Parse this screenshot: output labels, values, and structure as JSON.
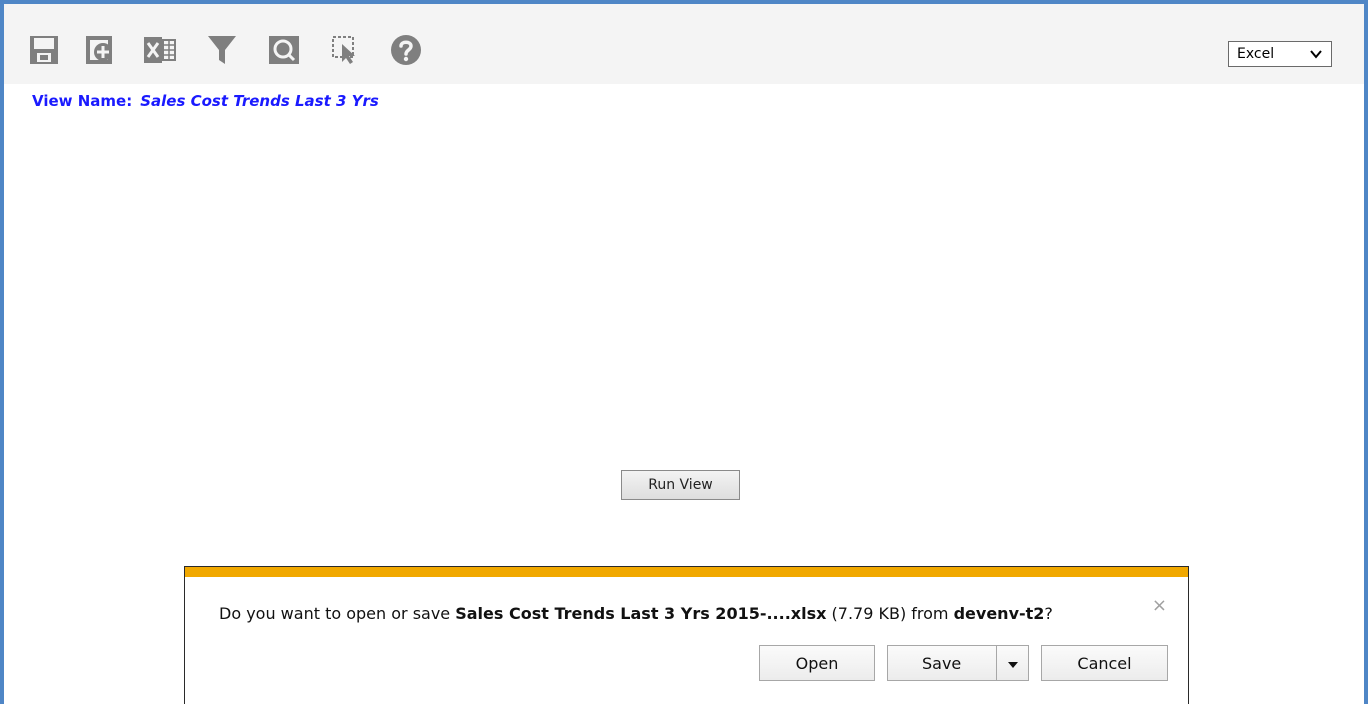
{
  "toolbar": {
    "icons": [
      "save-icon",
      "add-view-icon",
      "excel-export-icon",
      "filter-icon",
      "preview-icon",
      "select-pointer-icon",
      "help-icon"
    ],
    "format_select": {
      "value": "Excel"
    }
  },
  "view": {
    "label": "View Name:",
    "value": "Sales Cost Trends Last 3 Yrs"
  },
  "run_view": {
    "label": "Run View"
  },
  "download_bar": {
    "prefix": "Do you want to open or save ",
    "filename": "Sales Cost Trends Last 3 Yrs 2015-....xlsx",
    "size": " (7.79 KB) from ",
    "source": "devenv-t2",
    "suffix": "?",
    "close": "×",
    "buttons": {
      "open": "Open",
      "save": "Save",
      "cancel": "Cancel"
    }
  },
  "colors": {
    "accent_border": "#4f86c6",
    "view_name": "#1a1aff",
    "notification_bar": "#f1a800"
  }
}
